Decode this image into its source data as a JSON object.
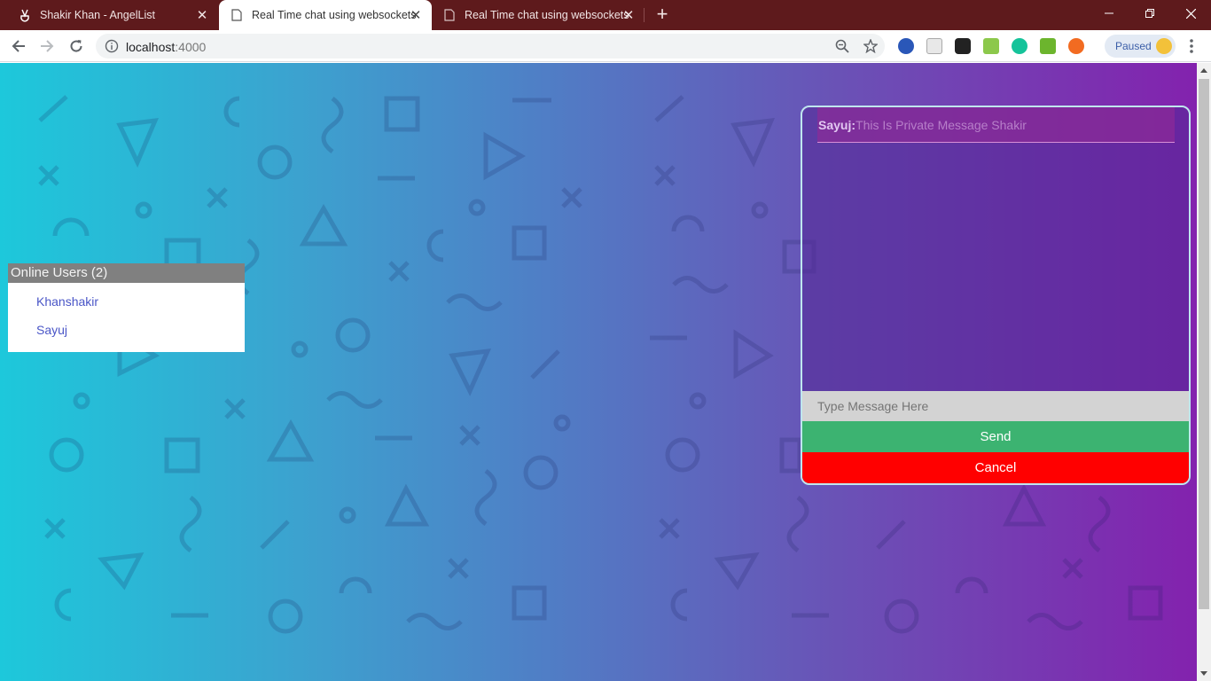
{
  "browser": {
    "tabs": [
      {
        "title": "Shakir Khan - AngelList",
        "icon": "angellist-icon",
        "active": false
      },
      {
        "title": "Real Time chat using websockets",
        "icon": "page-icon",
        "active": true
      },
      {
        "title": "Real Time chat using websockets",
        "icon": "page-icon",
        "active": false
      }
    ],
    "url_host": "localhost",
    "url_port": ":4000",
    "profile_label": "Paused",
    "frame_color": "#5e1a1c"
  },
  "users_panel": {
    "title": "Online Users (2)",
    "users": [
      "Khanshakir",
      "Sayuj"
    ]
  },
  "chat": {
    "messages": [
      {
        "sender": "Sayuj:",
        "text": "This Is Private Message Shakir"
      }
    ],
    "input_placeholder": "Type Message Here",
    "send_label": "Send",
    "cancel_label": "Cancel",
    "send_color": "#3cb371",
    "cancel_color": "#ff0000"
  }
}
